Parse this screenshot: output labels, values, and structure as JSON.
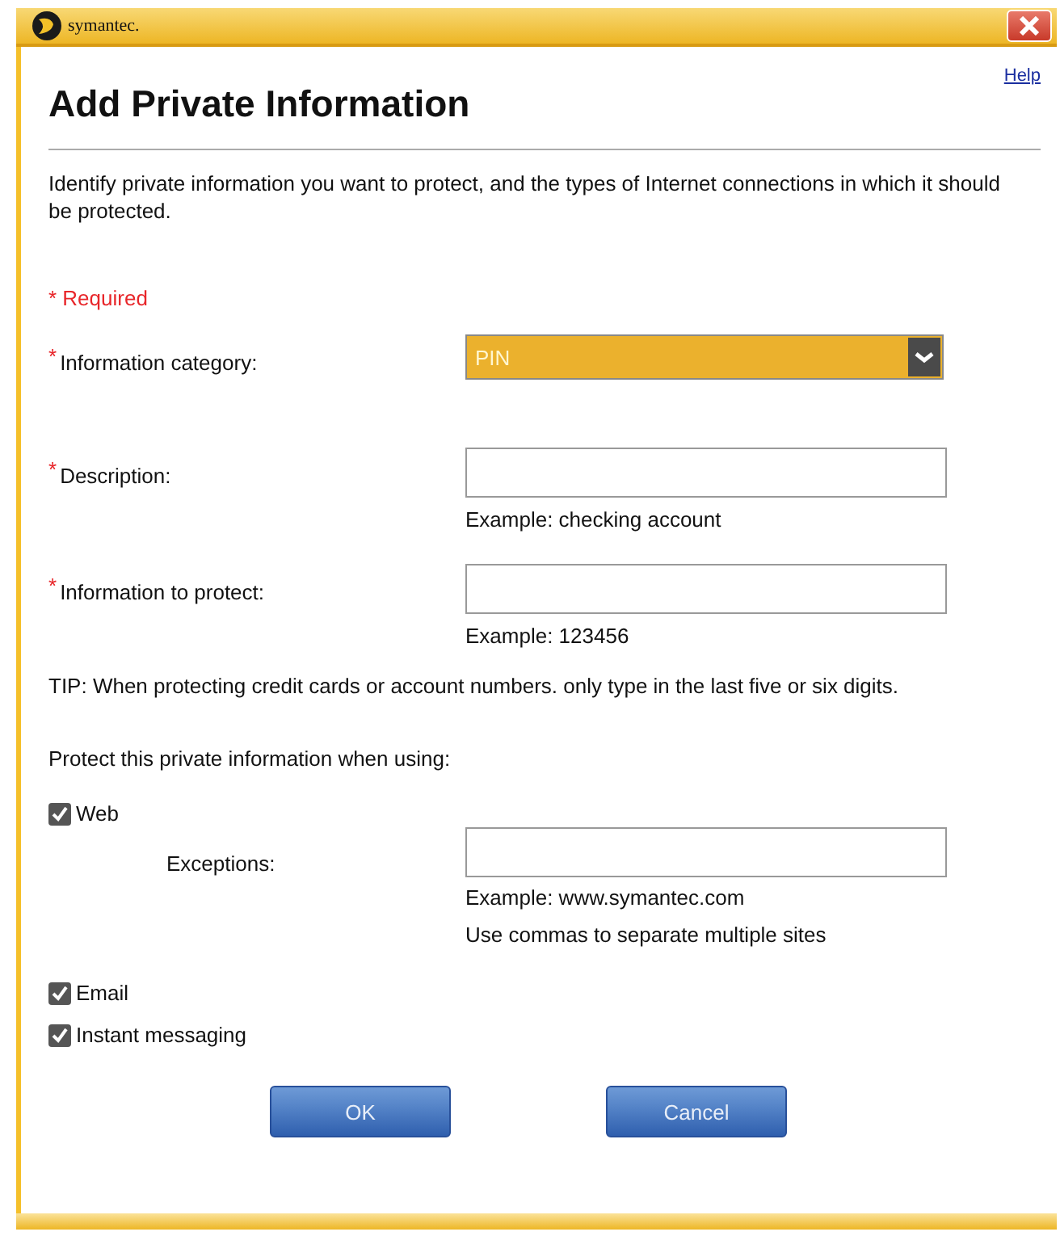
{
  "window": {
    "title": "symantec."
  },
  "help_link": "Help",
  "heading": "Add Private Information",
  "intro": "Identify private information you want to protect, and the types of Internet connections in which it should be protected.",
  "required_note": "* Required",
  "fields": [
    {
      "kind": "select",
      "marker": "*",
      "label": "Information category:",
      "value": "PIN"
    },
    {
      "kind": "text",
      "marker": "*",
      "label": "Description:",
      "hint": "Example: checking account"
    },
    {
      "kind": "text",
      "marker": "*",
      "label": "Information to protect:",
      "hint": "Example: 123456"
    }
  ],
  "tip": "TIP: When protecting credit cards or account numbers. only type in the last five or six digits.",
  "protect_label": "Protect this private information when using:",
  "protect_options": [
    {
      "label": "Web",
      "checked": true,
      "exceptions": {
        "label": "Exceptions:",
        "hints": [
          "Example: www.symantec.com",
          "Use commas to separate multiple sites"
        ]
      }
    },
    {
      "label": "Email",
      "checked": true
    },
    {
      "label": "Instant messaging",
      "checked": true
    }
  ],
  "buttons": [
    "OK",
    "Cancel"
  ]
}
